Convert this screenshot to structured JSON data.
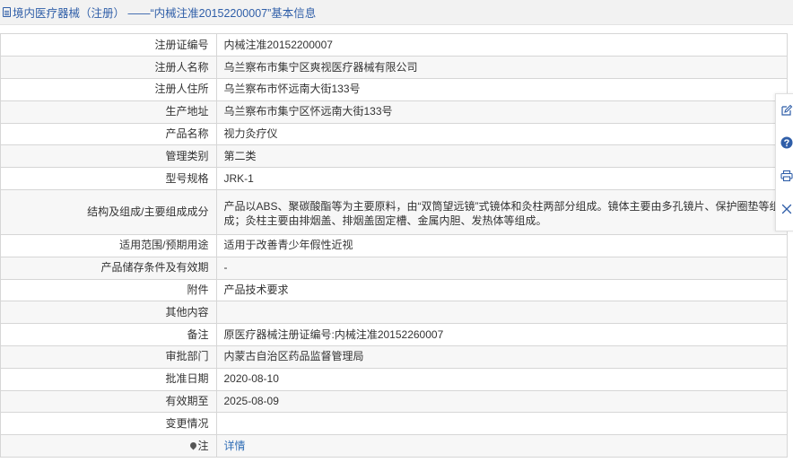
{
  "header": {
    "title": "境内医疗器械（注册） ——“内械注准20152200007”基本信息"
  },
  "rows": [
    {
      "label": "注册证编号",
      "value": "内械注准20152200007"
    },
    {
      "label": "注册人名称",
      "value": "乌兰察布市集宁区爽视医疗器械有限公司"
    },
    {
      "label": "注册人住所",
      "value": "乌兰察布市怀远南大街133号"
    },
    {
      "label": "生产地址",
      "value": "乌兰察布市集宁区怀远南大街133号"
    },
    {
      "label": "产品名称",
      "value": "视力灸疗仪"
    },
    {
      "label": "管理类别",
      "value": "第二类"
    },
    {
      "label": "型号规格",
      "value": "JRK-1"
    },
    {
      "label": "结构及组成/主要组成成分",
      "value": "产品以ABS、聚碳酸酯等为主要原料，由“双筒望远镜”式镜体和灸柱两部分组成。镜体主要由多孔镜片、保护圈垫等组成；灸柱主要由排烟盖、排烟盖固定槽、金属内胆、发热体等组成。"
    },
    {
      "label": "适用范围/预期用途",
      "value": "适用于改善青少年假性近视"
    },
    {
      "label": "产品储存条件及有效期",
      "value": "-"
    },
    {
      "label": "附件",
      "value": "产品技术要求"
    },
    {
      "label": "其他内容",
      "value": ""
    },
    {
      "label": "备注",
      "value": "原医疗器械注册证编号:内械注准20152260007"
    },
    {
      "label": "审批部门",
      "value": "内蒙古自治区药品监督管理局"
    },
    {
      "label": "批准日期",
      "value": "2020-08-10"
    },
    {
      "label": "有效期至",
      "value": "2025-08-09"
    },
    {
      "label": "变更情况",
      "value": ""
    },
    {
      "label": "注",
      "value": "详情"
    }
  ],
  "colors": {
    "accent": "#2f5ea8",
    "link": "#2f6db5",
    "border": "#d6d6d6",
    "stripe": "#f7f7f7"
  },
  "icons": [
    "document-icon",
    "edit-icon",
    "help-icon",
    "print-icon",
    "close-icon",
    "pin-icon"
  ]
}
